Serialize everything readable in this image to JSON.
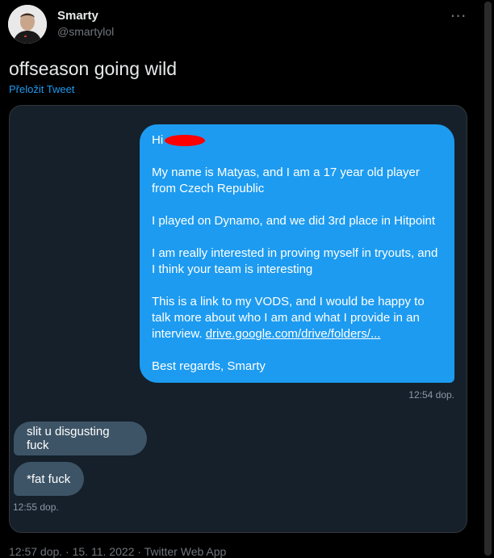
{
  "author": {
    "name": "Smarty",
    "handle": "@smartylol"
  },
  "tweet": {
    "text": "offseason going wild",
    "translate_label": "Přeložit Tweet"
  },
  "more_icon": "⋯",
  "dm": {
    "outgoing": {
      "greeting": "Hi",
      "p1": "My name is Matyas, and I am a 17 year old player from Czech Republic",
      "p2": "I played on Dynamo, and we did 3rd place in Hitpoint",
      "p3": "I am really interested in proving myself in tryouts, and I think your team is interesting",
      "p4_prefix": "This is a link to my VODS, and I would be happy to talk more about who I am and what I provide in an interview.",
      "p4_link": "drive.google.com/drive/folders/...",
      "closing": "Best regards, Smarty",
      "time": "12:54 dop."
    },
    "incoming": [
      {
        "text": "slit u disgusting fuck"
      },
      {
        "text": "*fat fuck"
      }
    ],
    "incoming_time": "12:55 dop."
  },
  "meta": {
    "line": "12:57 dop. · 15. 11. 2022 · Twitter Web App"
  },
  "colors": {
    "accent": "#1d9bf0",
    "background": "#000000",
    "card": "#15202b",
    "incoming_bubble": "#3d5466",
    "redaction": "#ff0000"
  }
}
